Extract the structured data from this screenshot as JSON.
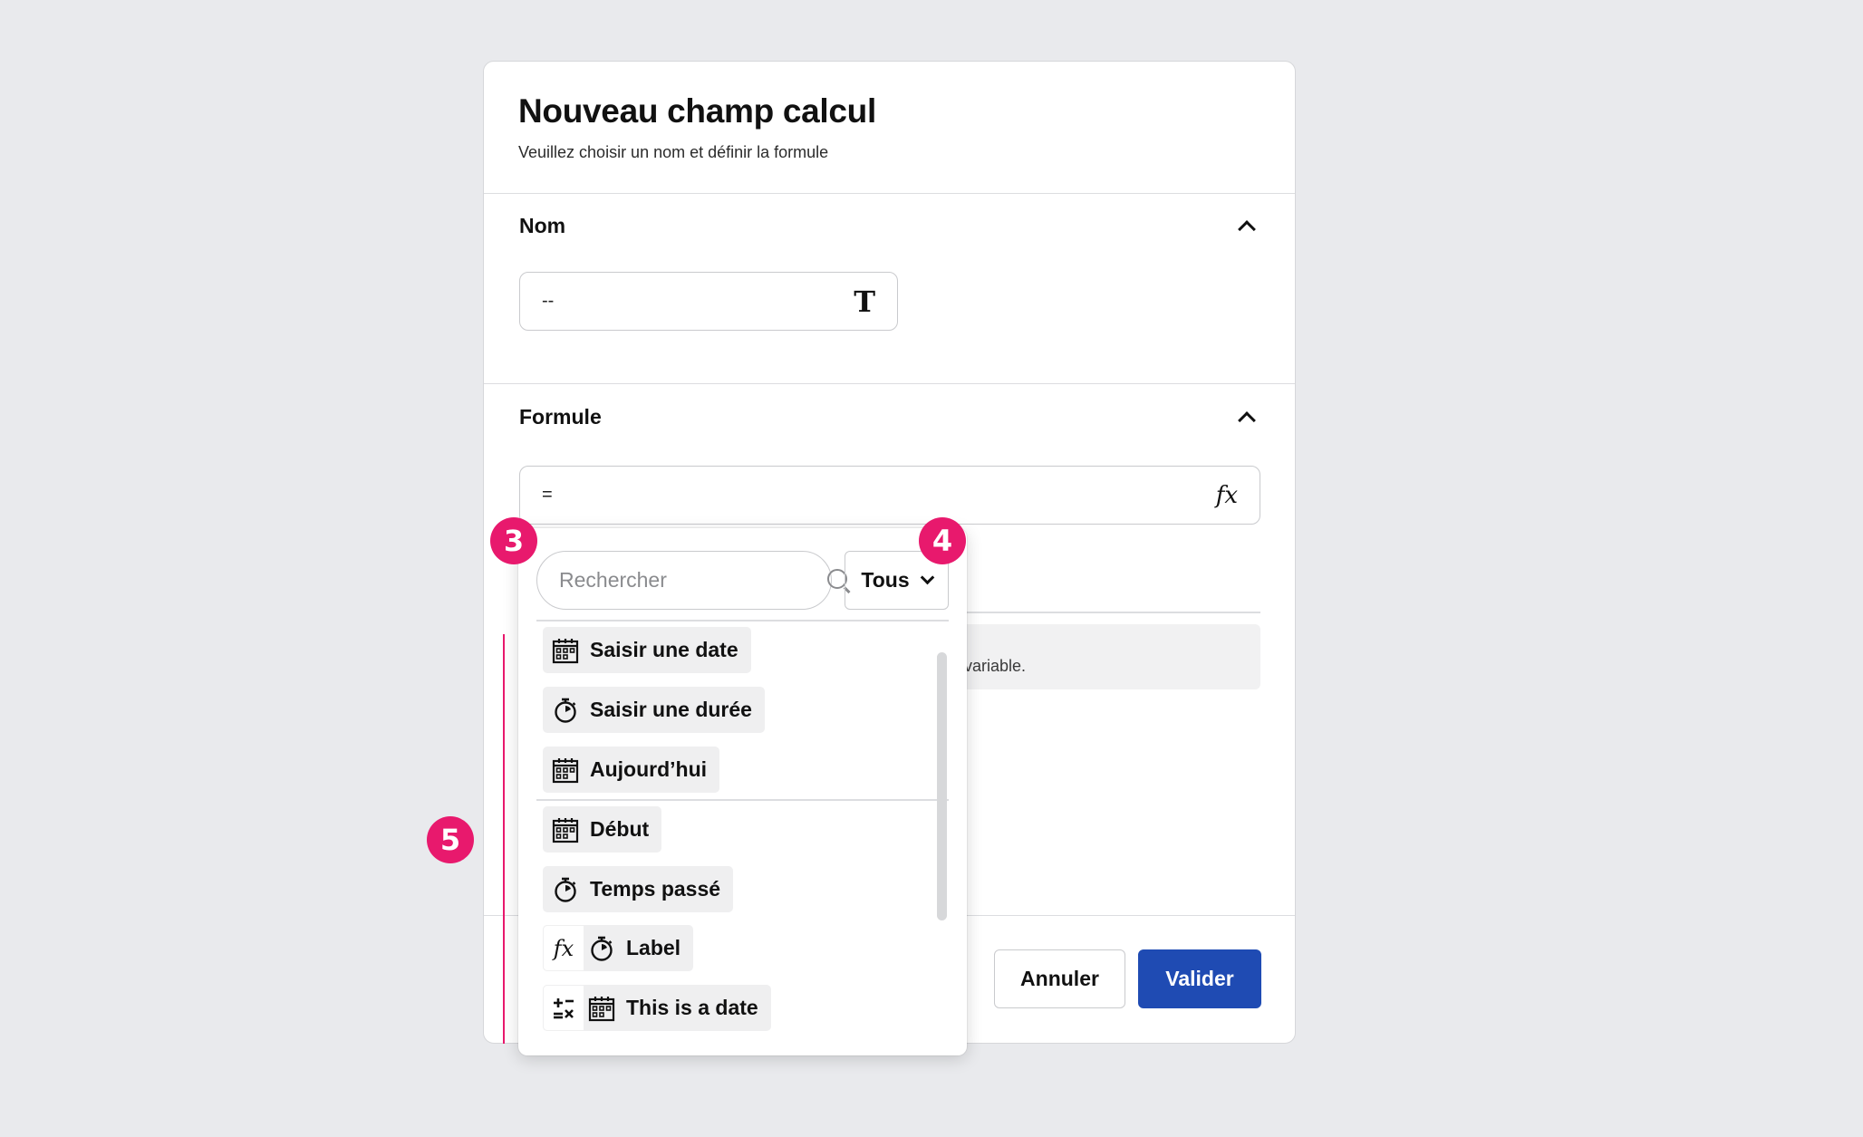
{
  "modal": {
    "title": "Nouveau champ calcul",
    "subtitle": "Veuillez choisir un nom et définir la formule"
  },
  "name_section": {
    "label": "Nom",
    "value": "--",
    "type_icon": "text-type-icon",
    "type_glyph": "T"
  },
  "formula_section": {
    "label": "Formule",
    "value": "=",
    "fx_glyph": "fx",
    "info_text_fragment": "la variable."
  },
  "dropdown": {
    "search_placeholder": "Rechercher",
    "filter_value": "Tous",
    "items": [
      {
        "label": "Saisir une date",
        "icon": "calendar-icon"
      },
      {
        "label": "Saisir une durée",
        "icon": "stopwatch-icon"
      },
      {
        "label": "Aujourd’hui",
        "icon": "calendar-icon"
      },
      {
        "label": "Début",
        "icon": "calendar-icon"
      },
      {
        "label": "Temps passé",
        "icon": "stopwatch-icon"
      },
      {
        "label": "Label",
        "icon": "stopwatch-icon",
        "prefix": "fx-icon"
      },
      {
        "label": "This is a date",
        "icon": "calendar-icon",
        "prefix": "operations-icon"
      }
    ]
  },
  "footer": {
    "cancel_label": "Annuler",
    "ok_label": "Valider"
  },
  "annotations": {
    "m3": "3",
    "m4": "4",
    "m5": "5"
  },
  "colors": {
    "primary": "#1f4bb3",
    "annotation": "#e8196d",
    "background": "#e9eaed"
  }
}
